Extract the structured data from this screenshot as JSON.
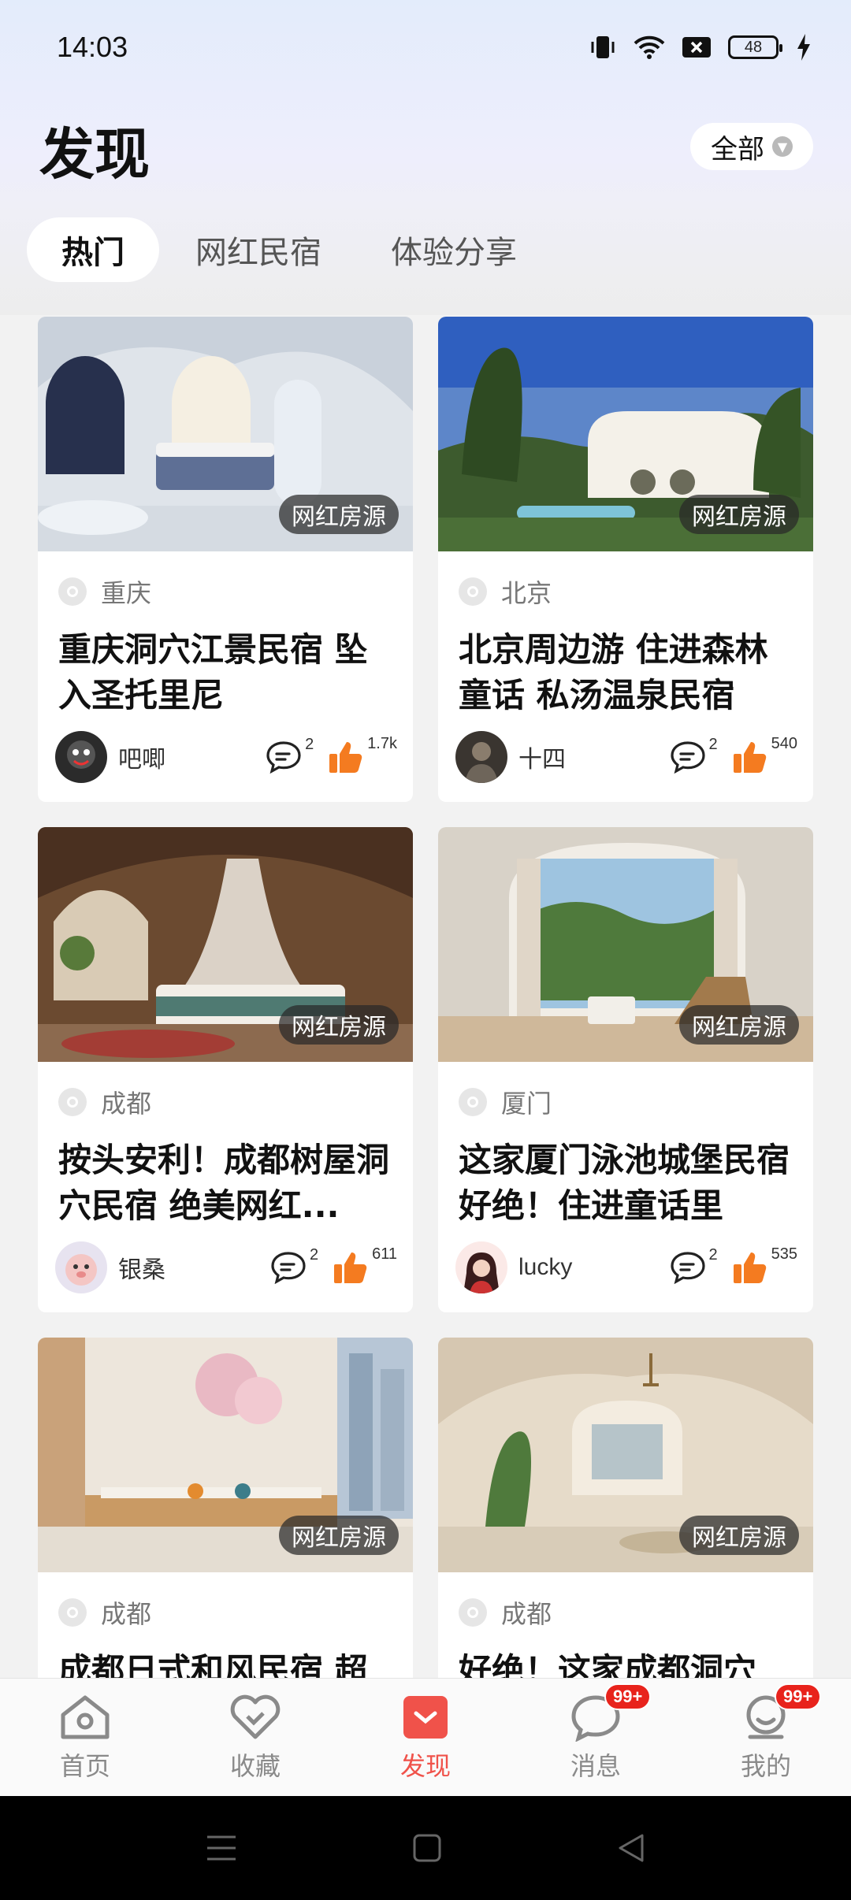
{
  "status_bar": {
    "time": "14:03",
    "battery": "48"
  },
  "header": {
    "title": "发现",
    "filter_label": "全部"
  },
  "tabs": [
    {
      "label": "热门",
      "active": true
    },
    {
      "label": "网红民宿",
      "active": false
    },
    {
      "label": "体验分享",
      "active": false
    }
  ],
  "cards": [
    {
      "tag": "网红房源",
      "location": "重庆",
      "title": "重庆洞穴江景民宿 坠入圣托里尼",
      "user": "吧唧",
      "comments": "2",
      "likes": "1.7k"
    },
    {
      "tag": "网红房源",
      "location": "北京",
      "title": "北京周边游 住进森林童话 私汤温泉民宿",
      "user": "十四",
      "comments": "2",
      "likes": "540"
    },
    {
      "tag": "网红房源",
      "location": "成都",
      "title": "按头安利！成都树屋洞穴民宿 绝美网红...",
      "user": "银桑",
      "comments": "2",
      "likes": "611"
    },
    {
      "tag": "网红房源",
      "location": "厦门",
      "title": "这家厦门泳池城堡民宿好绝！住进童话里",
      "user": "lucky",
      "comments": "2",
      "likes": "535"
    },
    {
      "tag": "网红房源",
      "location": "成都",
      "title": "成都日式和风民宿 超",
      "user": "",
      "comments": "",
      "likes": ""
    },
    {
      "tag": "网红房源",
      "location": "成都",
      "title": "好绝！这家成都洞穴",
      "user": "",
      "comments": "",
      "likes": ""
    }
  ],
  "nav": [
    {
      "label": "首页",
      "icon": "home-icon",
      "active": false
    },
    {
      "label": "收藏",
      "icon": "heart-icon",
      "active": false
    },
    {
      "label": "发现",
      "icon": "discover-icon",
      "active": true
    },
    {
      "label": "消息",
      "icon": "message-icon",
      "active": false,
      "badge": "99+"
    },
    {
      "label": "我的",
      "icon": "profile-icon",
      "active": false,
      "badge": "99+"
    }
  ],
  "colors": {
    "accent": "#f0524a",
    "like": "#f47b20",
    "badge": "#e8231c"
  }
}
